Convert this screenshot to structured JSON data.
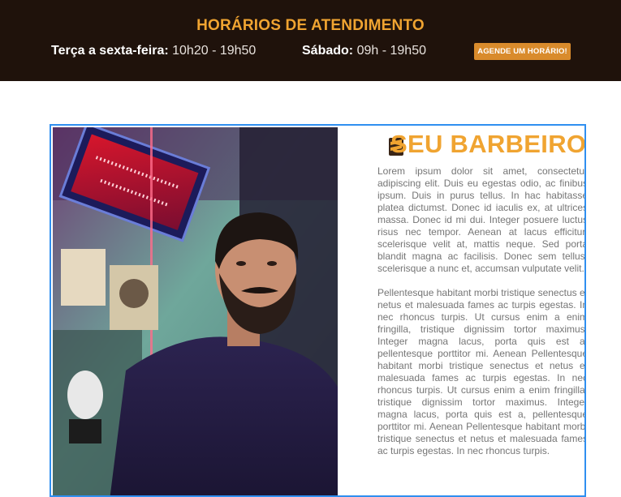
{
  "header": {
    "title": "HORÁRIOS DE ATENDIMENTO",
    "weekday_label": "Terça a sexta-feira:",
    "weekday_hours": "10h20 - 19h50",
    "saturday_label": "Sábado:",
    "saturday_hours": "09h - 19h50",
    "book_button": "AGENDE UM HORÁRIO!"
  },
  "barber": {
    "title": "SEU BARBEIRO",
    "paragraphs": [
      "Lorem ipsum dolor sit amet, consectetur adipiscing elit. Duis eu egestas odio, ac finibus ipsum. Duis in purus tellus. In hac habitasse platea dictumst. Donec id iaculis ex, at ultrices massa. Donec id mi dui. Integer posuere luctus risus nec tempor. Aenean at lacus efficitur, scelerisque velit at, mattis neque. Sed porta blandit magna ac facilisis. Donec sem tellus, scelerisque a nunc et, accumsan vulputate velit.",
      "Pellentesque habitant morbi tristique senectus et netus et malesuada fames ac turpis egestas. In nec rhoncus turpis. Ut cursus enim a enim fringilla, tristique dignissim tortor maximus. Integer magna lacus, porta quis est a, pellentesque porttitor mi. Aenean Pellentesque habitant morbi tristique senectus et netus et malesuada fames ac turpis egestas. In nec rhoncus turpis. Ut cursus enim a enim fringilla, tristique dignissim tortor maximus. Integer magna lacus, porta quis est a, pellentesque porttitor mi. Aenean Pellentesque habitant morbi tristique senectus et netus et malesuada fames ac turpis egestas. In nec rhoncus turpis."
    ]
  },
  "colors": {
    "topbar_bg": "#1f120b",
    "accent": "#f0a431",
    "button_bg": "#d98b2c",
    "box_border": "#2f8ff0",
    "body_text": "#757575"
  },
  "icons": {
    "barber_logo": "barber-pole-logo-icon"
  }
}
